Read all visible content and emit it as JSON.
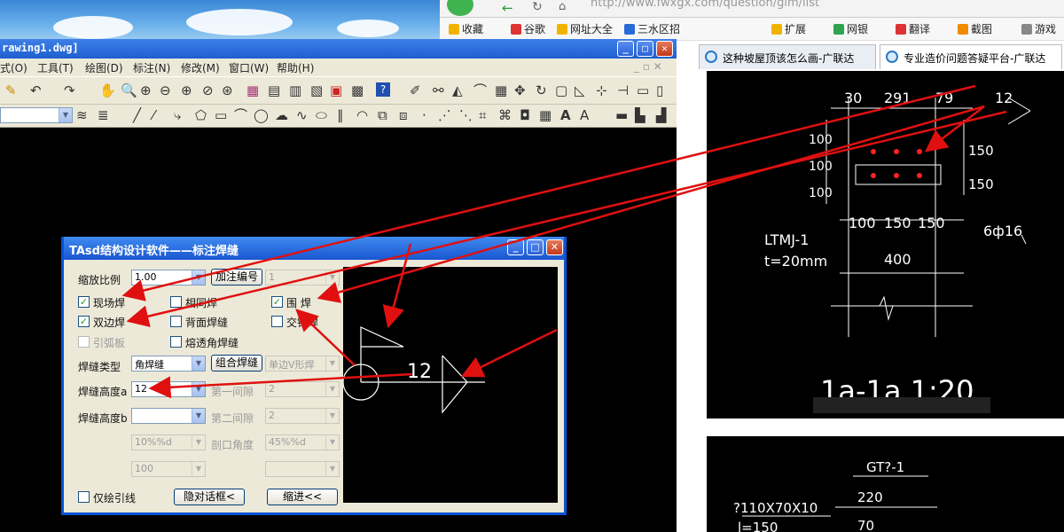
{
  "browser": {
    "address": "http://www.fwxgx.com/question/gim/list",
    "bookmarks": [
      {
        "label": "收藏",
        "color": "#f0b400"
      },
      {
        "label": "谷歌",
        "color": "#d33"
      },
      {
        "label": "网址大全",
        "color": "#f0b400"
      },
      {
        "label": "三水区招",
        "color": "#2a6ad6"
      },
      {
        "label": "扩展",
        "color": "#f0b400"
      },
      {
        "label": "网银",
        "color": "#2ea44f"
      },
      {
        "label": "翻译",
        "color": "#d33"
      },
      {
        "label": "截图",
        "color": "#f08a00"
      },
      {
        "label": "游戏",
        "color": "#888"
      }
    ],
    "tabs": [
      {
        "label": "这种坡屋顶该怎么画-广联达"
      },
      {
        "label": "专业造价问题答疑平台-广联达"
      }
    ]
  },
  "drawing": {
    "dims_top": [
      "30",
      "291",
      "79"
    ],
    "weld_size": "12",
    "dims_left": [
      "100",
      "100",
      "100"
    ],
    "dims_right": [
      "150",
      "150"
    ],
    "dims_bottom": [
      "100",
      "150",
      "150"
    ],
    "plate_label": "LTMJ-1",
    "plate_thk": "t=20mm",
    "width_dim": "400",
    "bolt_label": "6ф16",
    "section_title": "1a-1a 1:20",
    "second_label": "GT?-1",
    "second_dim": "220",
    "second_dim2": "70",
    "second_angle": "?110X70X10",
    "second_len": "l=150"
  },
  "cad": {
    "title": "rawing1.dwg]",
    "menu": [
      "式(O)",
      "工具(T)",
      "绘图(D)",
      "标注(N)",
      "修改(M)",
      "窗口(W)",
      "帮助(H)"
    ]
  },
  "dialog": {
    "title": "TAsd结构设计软件——标注焊缝",
    "scale_label": "缩放比例",
    "scale_value": "1.00",
    "add_number_btn": "加注编号",
    "number_value": "1",
    "cb_field_weld": "现场焊",
    "cb_same_weld": "相同焊",
    "cb_around_weld": "围  焊",
    "cb_double_side": "双边焊",
    "cb_back_weld": "背面焊缝",
    "cb_cross_weld": "交错焊",
    "cb_lead_plate": "引弧板",
    "cb_penetration": "熔透角焊缝",
    "weld_type_label": "焊缝类型",
    "weld_type_value": "角焊缝",
    "combine_btn": "组合焊缝",
    "single_v": "单边V形焊",
    "height_a_label": "焊缝高度a",
    "height_a_value": "12",
    "gap1_label": "第一间隙",
    "gap1_value": "2",
    "height_b_label": "焊缝高度b",
    "gap2_label": "第二间隙",
    "gap2_value": "2",
    "pct1": "10%%d",
    "angle_label": "剖口角度",
    "angle_value": "45%%d",
    "val100": "100",
    "only_leader": "仅绘引线",
    "hide_btn": "隐对话框<",
    "shrink_btn": "缩进<<",
    "preview_size": "12"
  }
}
